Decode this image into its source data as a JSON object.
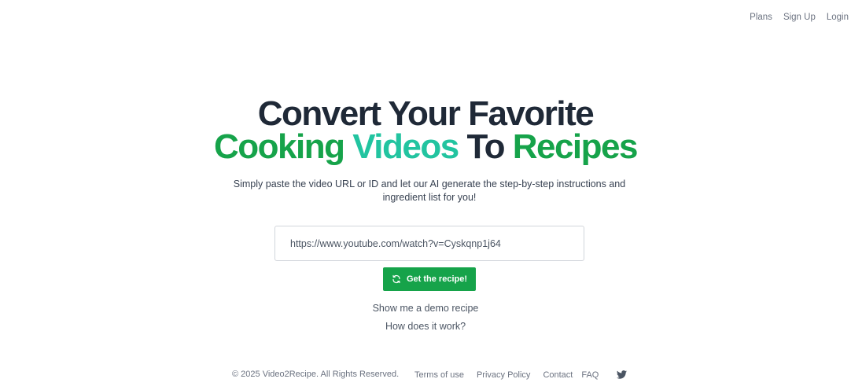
{
  "nav": {
    "plans": "Plans",
    "signup": "Sign Up",
    "login": "Login"
  },
  "hero": {
    "line1": "Convert Your Favorite",
    "word_cooking": "Cooking",
    "word_videos": "Videos",
    "word_to": "To",
    "word_recipes": "Recipes",
    "subtitle": "Simply paste the video URL or ID and let our AI generate the step-by-step instructions and ingredient list for you!"
  },
  "form": {
    "url_value": "https://www.youtube.com/watch?v=Cyskqnp1j64",
    "submit_label": "Get the recipe!"
  },
  "links": {
    "demo": "Show me a demo recipe",
    "how": "How does it work?"
  },
  "footer": {
    "copyright": "© 2025 Video2Recipe. All Rights Reserved.",
    "terms": "Terms of use",
    "privacy": "Privacy Policy",
    "contact": "Contact",
    "faq": "FAQ",
    "social_icon": "twitter-icon"
  },
  "colors": {
    "primary_green": "#16a34a",
    "teal": "#22c4a0",
    "heading": "#1f2937"
  }
}
